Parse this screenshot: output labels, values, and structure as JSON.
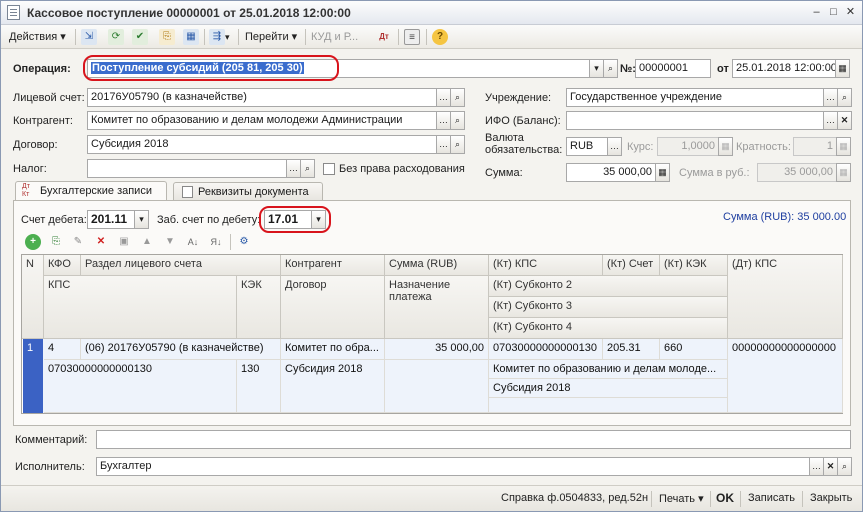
{
  "window": {
    "title": "Кассовое поступление 00000001 от 25.01.2018 12:00:00"
  },
  "toolbar": {
    "actions_label": "Действия",
    "goto_label": "Перейти",
    "kud_label": "КУД и Р..."
  },
  "header": {
    "operation_label": "Операция:",
    "operation_value": "Поступление субсидий (205 81, 205 30)",
    "number_label": "№:",
    "number_value": "00000001",
    "date_label": "от",
    "date_value": "25.01.2018 12:00:00"
  },
  "form": {
    "account_label": "Лицевой счет:",
    "account_value": "20176У05790 (в казначействе)",
    "counterparty_label": "Контрагент:",
    "counterparty_value": "Комитет по образованию и делам молодежи Администрации",
    "contract_label": "Договор:",
    "contract_value": "Субсидия 2018",
    "tax_label": "Налог:",
    "tax_value": "",
    "no_rights_label": "Без права расходования",
    "institution_label": "Учреждение:",
    "institution_value": "Государственное учреждение",
    "ifo_label": "ИФО (Баланс):",
    "ifo_value": "",
    "currency_label_1": "Валюта",
    "currency_label_2": "обязательства:",
    "currency_value": "RUB",
    "rate_label": "Курс:",
    "rate_value": "1,0000",
    "multiplicity_label": "Кратность:",
    "multiplicity_value": "1",
    "sum_label": "Сумма:",
    "sum_value": "35 000,00",
    "sum_rub_label": "Сумма в руб.:",
    "sum_rub_value": "35 000,00"
  },
  "tabs": [
    {
      "label": "Бухгалтерские записи"
    },
    {
      "label": "Реквизиты документа"
    }
  ],
  "entries": {
    "debit_account_label": "Счет дебета:",
    "debit_account_value": "201.11",
    "off_balance_label": "Заб. счет по дебету:",
    "off_balance_value": "17.01",
    "sum_rub_text": "Сумма (RUB): 35 000.00",
    "columns": {
      "n": "N",
      "kfo": "КФО",
      "section": "Раздел лицевого счета",
      "counterparty": "Контрагент",
      "sum": "Сумма (RUB)",
      "kt_kps": "(Кт) КПС",
      "kt_account": "(Кт) Счет",
      "kt_kek": "(Кт) КЭК",
      "dt_kps": "(Дт) КПС",
      "kps": "КПС",
      "kek": "КЭК",
      "contract": "Договор",
      "purpose": "Назначение платежа",
      "kt_sub2": "(Кт) Субконто 2",
      "kt_sub3": "(Кт) Субконто 3",
      "kt_sub4": "(Кт) Субконто 4"
    },
    "rows": [
      {
        "n": "1",
        "kfo": "4",
        "section": "(06) 20176У05790 (в казначействе)",
        "counterparty": "Комитет по обра...",
        "sum": "35 000,00",
        "kt_kps": "07030000000000130",
        "kt_account": "205.31",
        "kt_kek": "660",
        "dt_kps": "00000000000000000",
        "kps": "07030000000000130",
        "kek": "130",
        "contract": "Субсидия 2018",
        "purpose": "",
        "kt_sub2": "Комитет по образованию и делам молоде...",
        "kt_sub3": "Субсидия 2018",
        "kt_sub4": ""
      }
    ]
  },
  "footer": {
    "comment_label": "Комментарий:",
    "comment_value": "",
    "executor_label": "Исполнитель:",
    "executor_value": "Бухгалтер"
  },
  "statusbar": {
    "help_label": "Справка ф.0504833, ред.52н",
    "print_label": "Печать",
    "ok_label": "OK",
    "save_label": "Записать",
    "close_label": "Закрыть"
  },
  "colors": {
    "highlight_ring": "#d8141c",
    "selection": "#3a6ccd",
    "link_blue": "#1f3fa0"
  }
}
